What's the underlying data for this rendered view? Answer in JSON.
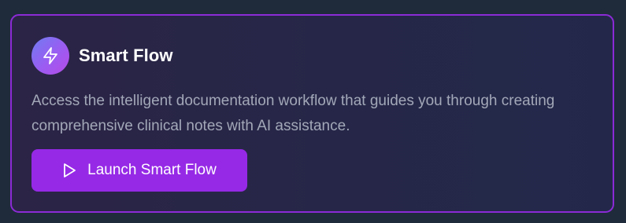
{
  "card": {
    "title": "Smart Flow",
    "icon": "lightning-bolt-icon",
    "description": "Access the intelligent documentation workflow that guides you through creating comprehensive clinical notes with AI assistance.",
    "button": {
      "label": "Launch Smart Flow",
      "icon": "play-icon"
    }
  },
  "colors": {
    "background": "#1f2a3b",
    "card_border": "#8b2bd6",
    "button": "#9629e6",
    "description_text": "#a3a8b8"
  }
}
